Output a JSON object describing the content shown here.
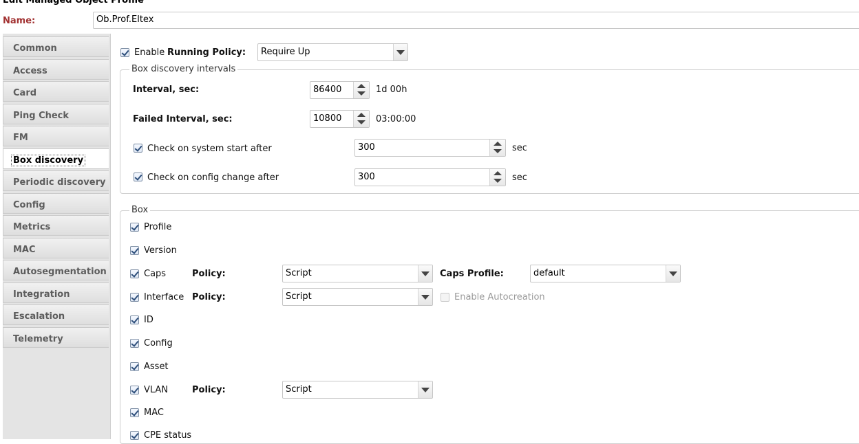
{
  "window": {
    "title": "Edit Managed Object Profile"
  },
  "name_field": {
    "label": "Name:",
    "value": "Ob.Prof.Eltex"
  },
  "sidebar": {
    "tabs": [
      {
        "label": "Common"
      },
      {
        "label": "Access"
      },
      {
        "label": "Card"
      },
      {
        "label": "Ping Check"
      },
      {
        "label": "FM"
      },
      {
        "label": "Box discovery",
        "active": true
      },
      {
        "label": "Periodic discovery"
      },
      {
        "label": "Config"
      },
      {
        "label": "Metrics"
      },
      {
        "label": "MAC"
      },
      {
        "label": "Autosegmentation"
      },
      {
        "label": "Integration"
      },
      {
        "label": "Escalation"
      },
      {
        "label": "Telemetry"
      }
    ]
  },
  "top": {
    "enable_label": "Enable",
    "enable_checked": true,
    "running_policy_label": "Running Policy:",
    "running_policy_value": "Require Up"
  },
  "intervals": {
    "legend": "Box discovery intervals",
    "interval_label": "Interval, sec:",
    "interval_value": "86400",
    "interval_human": "1d 00h",
    "failed_label": "Failed Interval, sec:",
    "failed_value": "10800",
    "failed_human": "03:00:00",
    "sys_start_label": "Check on system start after",
    "sys_start_value": "300",
    "sys_start_unit": "sec",
    "config_change_label": "Check on config change after",
    "config_change_value": "300",
    "config_change_unit": "sec"
  },
  "box": {
    "legend": "Box",
    "profile": "Profile",
    "version": "Version",
    "caps": "Caps",
    "caps_policy_label": "Policy:",
    "caps_policy_value": "Script",
    "caps_profile_label": "Caps Profile:",
    "caps_profile_value": "default",
    "interface": "Interface",
    "interface_policy_label": "Policy:",
    "interface_policy_value": "Script",
    "enable_autocreation": "Enable Autocreation",
    "id": "ID",
    "config": "Config",
    "asset": "Asset",
    "vlan": "VLAN",
    "vlan_policy_label": "Policy:",
    "vlan_policy_value": "Script",
    "mac": "MAC",
    "cpe_status": "CPE status"
  }
}
